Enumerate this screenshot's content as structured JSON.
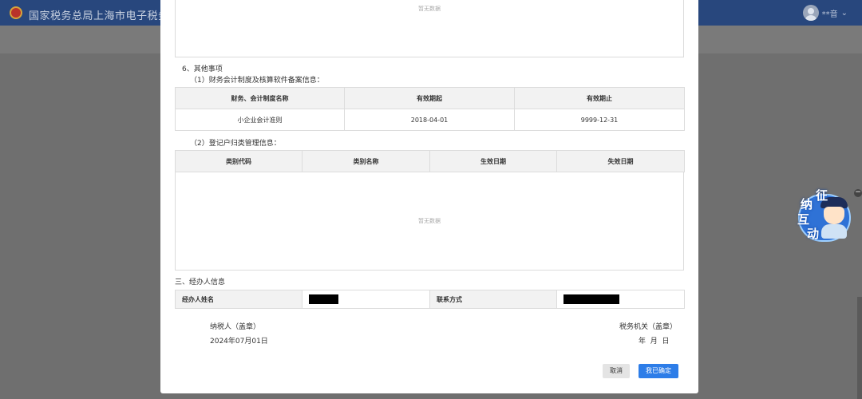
{
  "app": {
    "title": "国家税务总局上海市电子税务局",
    "user_name": "**音",
    "user_caret": "⌄"
  },
  "modal": {
    "top_empty_text": "暂无数据",
    "section6_title": "6、其他事项",
    "subsection1_title": "（1）财务会计制度及核算软件备案信息：",
    "table1": {
      "headers": [
        "财务、会计制度名称",
        "有效期起",
        "有效期止"
      ],
      "rows": [
        [
          "小企业会计准则",
          "2018-04-01",
          "9999-12-31"
        ]
      ]
    },
    "subsection2_title": "（2）登记户归类管理信息：",
    "table2": {
      "headers": [
        "类别代码",
        "类别名称",
        "生效日期",
        "失效日期"
      ],
      "empty_text": "暂无数据"
    },
    "section3_title": "三、经办人信息",
    "agent": {
      "name_label": "经办人姓名",
      "contact_label": "联系方式"
    },
    "signature": {
      "taxpayer_label": "纳税人（盖章）",
      "taxpayer_date": "2024年07月01日",
      "authority_label": "税务机关（盖章）",
      "authority_date": "年  月  日"
    },
    "buttons": {
      "cancel": "取消",
      "confirm": "我已确定"
    }
  },
  "widget": {
    "chars": [
      "征",
      "纳",
      "互",
      "动"
    ],
    "close": "−"
  }
}
